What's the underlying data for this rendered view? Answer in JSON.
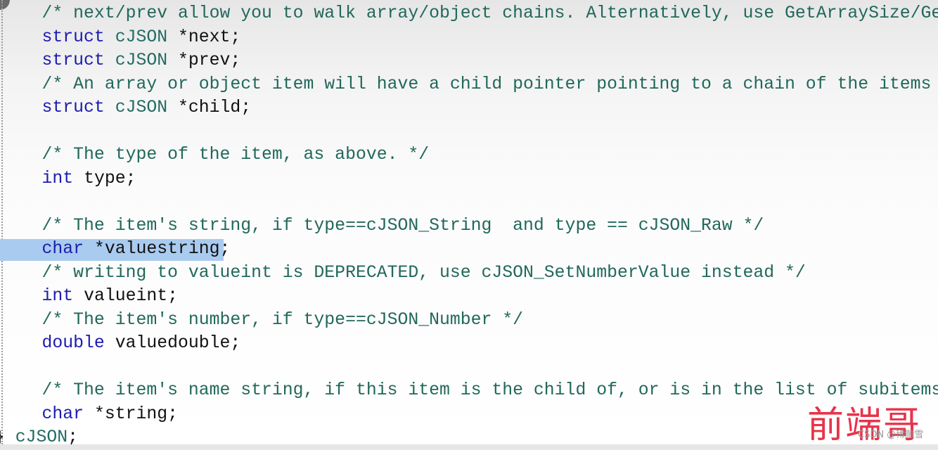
{
  "editor": {
    "lines": [
      {
        "indent": "    ",
        "tokens": [
          {
            "c": "cm",
            "t": "/* next/prev allow you to walk array/object chains. Alternatively, use GetArraySize/Get"
          }
        ]
      },
      {
        "indent": "    ",
        "tokens": [
          {
            "c": "kw",
            "t": "struct"
          },
          {
            "c": "id",
            "t": " "
          },
          {
            "c": "ty",
            "t": "cJSON"
          },
          {
            "c": "id",
            "t": " *next;"
          }
        ]
      },
      {
        "indent": "    ",
        "tokens": [
          {
            "c": "kw",
            "t": "struct"
          },
          {
            "c": "id",
            "t": " "
          },
          {
            "c": "ty",
            "t": "cJSON"
          },
          {
            "c": "id",
            "t": " *prev;"
          }
        ]
      },
      {
        "indent": "    ",
        "tokens": [
          {
            "c": "cm",
            "t": "/* An array or object item will have a child pointer pointing to a chain of the items i"
          }
        ]
      },
      {
        "indent": "    ",
        "tokens": [
          {
            "c": "kw",
            "t": "struct"
          },
          {
            "c": "id",
            "t": " "
          },
          {
            "c": "ty",
            "t": "cJSON"
          },
          {
            "c": "id",
            "t": " *child;"
          }
        ]
      },
      {
        "indent": "",
        "tokens": []
      },
      {
        "indent": "    ",
        "tokens": [
          {
            "c": "cm",
            "t": "/* The type of the item, as above. */"
          }
        ]
      },
      {
        "indent": "    ",
        "tokens": [
          {
            "c": "kw",
            "t": "int"
          },
          {
            "c": "id",
            "t": " type;"
          }
        ]
      },
      {
        "indent": "",
        "tokens": []
      },
      {
        "indent": "    ",
        "tokens": [
          {
            "c": "cm",
            "t": "/* The item's string, if type==cJSON_String  and type == cJSON_Raw */"
          }
        ]
      },
      {
        "indent": "    ",
        "highlight": true,
        "tokens": [
          {
            "c": "kw",
            "t": "char"
          },
          {
            "c": "id",
            "t": " *valuestring;"
          }
        ]
      },
      {
        "indent": "    ",
        "tokens": [
          {
            "c": "cm",
            "t": "/* writing to valueint is DEPRECATED, use cJSON_SetNumberValue instead */"
          }
        ]
      },
      {
        "indent": "    ",
        "tokens": [
          {
            "c": "kw",
            "t": "int"
          },
          {
            "c": "id",
            "t": " valueint;"
          }
        ]
      },
      {
        "indent": "    ",
        "tokens": [
          {
            "c": "cm",
            "t": "/* The item's number, if type==cJSON_Number */"
          }
        ]
      },
      {
        "indent": "    ",
        "tokens": [
          {
            "c": "kw",
            "t": "double"
          },
          {
            "c": "id",
            "t": " valuedouble;"
          }
        ]
      },
      {
        "indent": "",
        "tokens": []
      },
      {
        "indent": "    ",
        "tokens": [
          {
            "c": "cm",
            "t": "/* The item's name string, if this item is the child of, or is in the list of subitems"
          }
        ]
      },
      {
        "indent": "    ",
        "tokens": [
          {
            "c": "kw",
            "t": "char"
          },
          {
            "c": "id",
            "t": " *string;"
          }
        ]
      },
      {
        "indent": "",
        "tokens": [
          {
            "c": "id",
            "t": "} "
          },
          {
            "c": "ty",
            "t": "cJSON"
          },
          {
            "c": "id",
            "t": ";"
          }
        ]
      }
    ],
    "highlight_color": "#a9cbef"
  },
  "watermark": {
    "logo_text": "前端哥",
    "credit": "CSDN @稀融雪"
  }
}
